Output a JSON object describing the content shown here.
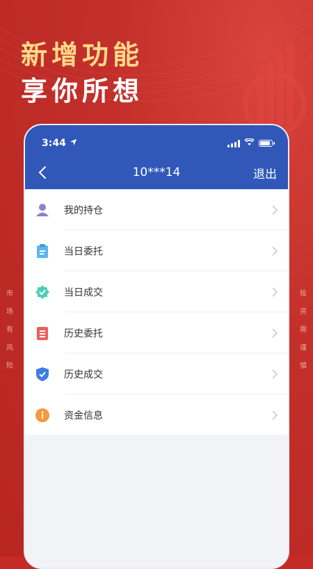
{
  "promo": {
    "headline_line1": "新增功能",
    "headline_line2": "享你所想",
    "left_vertical": [
      "市",
      "场",
      "有",
      "风",
      "险"
    ],
    "right_vertical": [
      "投",
      "资",
      "需",
      "谨",
      "慎"
    ]
  },
  "status_bar": {
    "time": "3:44"
  },
  "nav": {
    "title": "10***14",
    "logout_label": "退出"
  },
  "menu": [
    {
      "label": "我的持仓",
      "icon": "user-icon"
    },
    {
      "label": "当日委托",
      "icon": "clipboard-icon"
    },
    {
      "label": "当日成交",
      "icon": "check-badge-icon"
    },
    {
      "label": "历史委托",
      "icon": "document-icon"
    },
    {
      "label": "历史成交",
      "icon": "shield-check-icon"
    },
    {
      "label": "资金信息",
      "icon": "info-icon"
    }
  ],
  "colors": {
    "brand_red": "#c62a26",
    "nav_blue": "#3157b9",
    "headline_gold": "#ffd98a"
  }
}
